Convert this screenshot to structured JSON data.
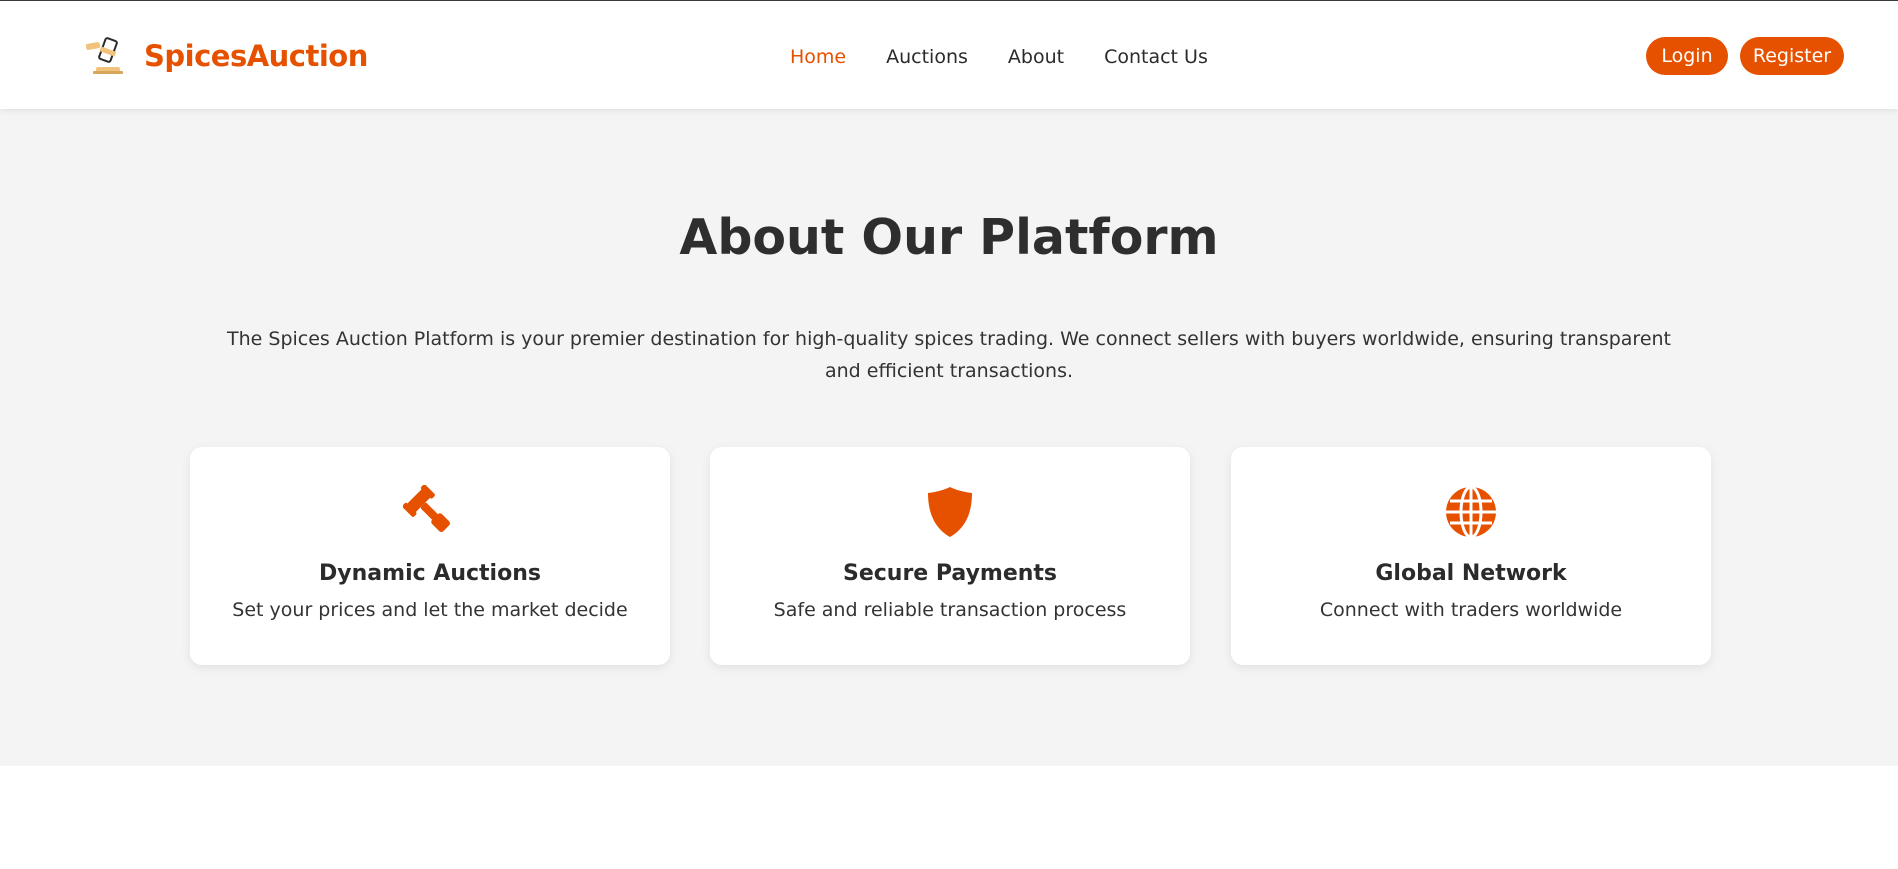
{
  "brand": {
    "name": "SpicesAuction",
    "color": "#e65100"
  },
  "nav": {
    "items": [
      {
        "label": "Home",
        "active": true
      },
      {
        "label": "Auctions",
        "active": false
      },
      {
        "label": "About",
        "active": false
      },
      {
        "label": "Contact Us",
        "active": false
      }
    ]
  },
  "auth": {
    "login_label": "Login",
    "register_label": "Register"
  },
  "about": {
    "title": "About Our Platform",
    "description": "The Spices Auction Platform is your premier destination for high-quality spices trading. We connect sellers with buyers worldwide, ensuring transparent and efficient transactions.",
    "features": [
      {
        "icon": "gavel-icon",
        "title": "Dynamic Auctions",
        "text": "Set your prices and let the market decide"
      },
      {
        "icon": "shield-icon",
        "title": "Secure Payments",
        "text": "Safe and reliable transaction process"
      },
      {
        "icon": "globe-icon",
        "title": "Global Network",
        "text": "Connect with traders worldwide"
      }
    ]
  },
  "colors": {
    "accent": "#e65100",
    "section_bg": "#f4f4f4",
    "text": "#2b2b2b"
  }
}
